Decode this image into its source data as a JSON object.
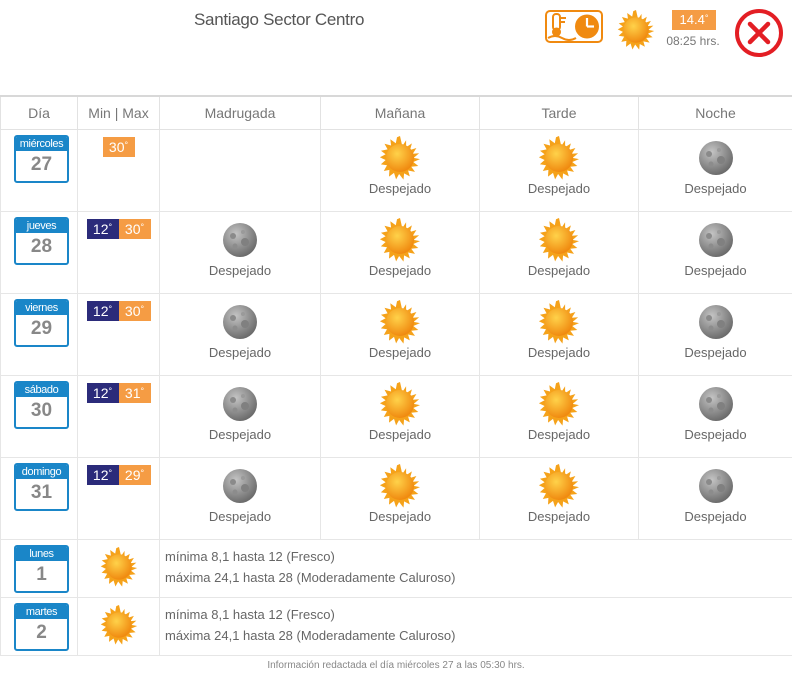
{
  "header": {
    "location": "Santiago Sector Centro",
    "current_temp": "14.4",
    "current_time": "08:25 hrs.",
    "colors": {
      "orange": "#f59c44",
      "navy": "#2b2b7a",
      "blue": "#1a86c8",
      "red": "#e31e24"
    }
  },
  "columns": [
    "Día",
    "Min | Max",
    "Madrugada",
    "Mañana",
    "Tarde",
    "Noche"
  ],
  "days": [
    {
      "name": "miércoles",
      "num": "27",
      "min": "",
      "max": "30",
      "periods": [
        {
          "icon": "",
          "cond": ""
        },
        {
          "icon": "sun",
          "cond": "Despejado"
        },
        {
          "icon": "sun",
          "cond": "Despejado"
        },
        {
          "icon": "moon",
          "cond": "Despejado"
        }
      ]
    },
    {
      "name": "jueves",
      "num": "28",
      "min": "12",
      "max": "30",
      "periods": [
        {
          "icon": "moon",
          "cond": "Despejado"
        },
        {
          "icon": "sun",
          "cond": "Despejado"
        },
        {
          "icon": "sun",
          "cond": "Despejado"
        },
        {
          "icon": "moon",
          "cond": "Despejado"
        }
      ]
    },
    {
      "name": "viernes",
      "num": "29",
      "min": "12",
      "max": "30",
      "periods": [
        {
          "icon": "moon",
          "cond": "Despejado"
        },
        {
          "icon": "sun",
          "cond": "Despejado"
        },
        {
          "icon": "sun",
          "cond": "Despejado"
        },
        {
          "icon": "moon",
          "cond": "Despejado"
        }
      ]
    },
    {
      "name": "sábado",
      "num": "30",
      "min": "12",
      "max": "31",
      "periods": [
        {
          "icon": "moon",
          "cond": "Despejado"
        },
        {
          "icon": "sun",
          "cond": "Despejado"
        },
        {
          "icon": "sun",
          "cond": "Despejado"
        },
        {
          "icon": "moon",
          "cond": "Despejado"
        }
      ]
    },
    {
      "name": "domingo",
      "num": "31",
      "min": "12",
      "max": "29",
      "periods": [
        {
          "icon": "moon",
          "cond": "Despejado"
        },
        {
          "icon": "sun",
          "cond": "Despejado"
        },
        {
          "icon": "sun",
          "cond": "Despejado"
        },
        {
          "icon": "moon",
          "cond": "Despejado"
        }
      ]
    }
  ],
  "extended": [
    {
      "name": "lunes",
      "num": "1",
      "icon": "sun",
      "line1": "mínima 8,1 hasta 12 (Fresco)",
      "line2": "máxima 24,1 hasta 28 (Moderadamente Caluroso)"
    },
    {
      "name": "martes",
      "num": "2",
      "icon": "sun",
      "line1": "mínima 8,1 hasta 12 (Fresco)",
      "line2": "máxima 24,1 hasta 28 (Moderadamente Caluroso)"
    }
  ],
  "footer": "Información redactada el día miércoles 27 a las 05:30 hrs."
}
